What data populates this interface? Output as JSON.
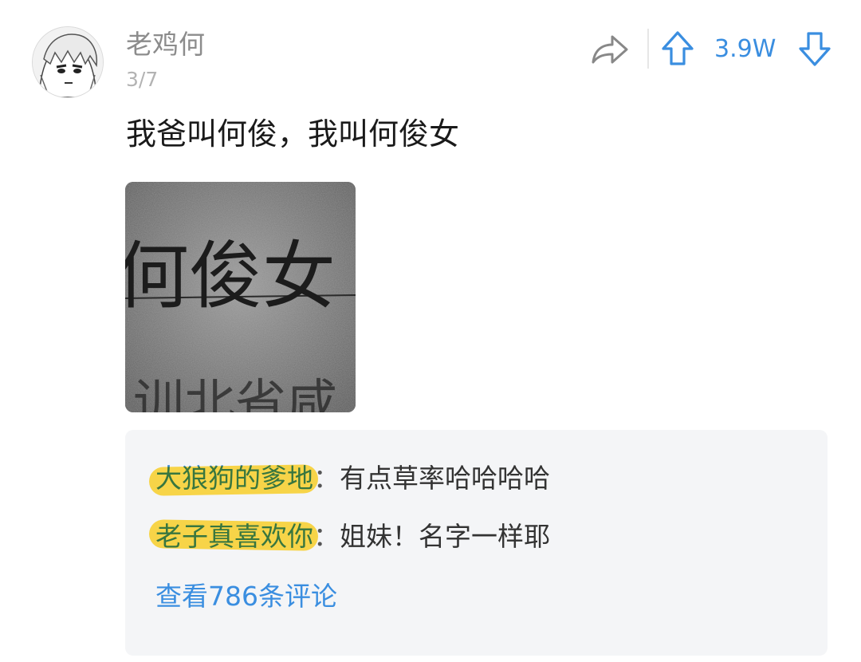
{
  "post": {
    "author": {
      "name": "老鸡何",
      "avatar_icon": "anime-avatar-icon"
    },
    "time": "3/7",
    "text": "我爸叫何俊，我叫何俊女",
    "image": {
      "text": "何俊女"
    },
    "actions": {
      "share_icon": "share-arrow-icon",
      "upvote_icon": "up-arrow-icon",
      "downvote_icon": "down-arrow-icon",
      "vote_count": "3.9W"
    }
  },
  "comments": {
    "items": [
      {
        "user": "大狼狗的爹地",
        "separator": "：",
        "text": "有点草率哈哈哈哈"
      },
      {
        "user": "老子真喜欢你",
        "separator": "：",
        "text": "姐妹！名字一样耶"
      }
    ],
    "view_all_label": "查看786条评论"
  },
  "colors": {
    "link": "#3a8ee0",
    "text": "#1a1a1a",
    "muted": "#8c8c8c",
    "comment_bg": "#f4f5f7",
    "redaction": "#f7d23e"
  }
}
